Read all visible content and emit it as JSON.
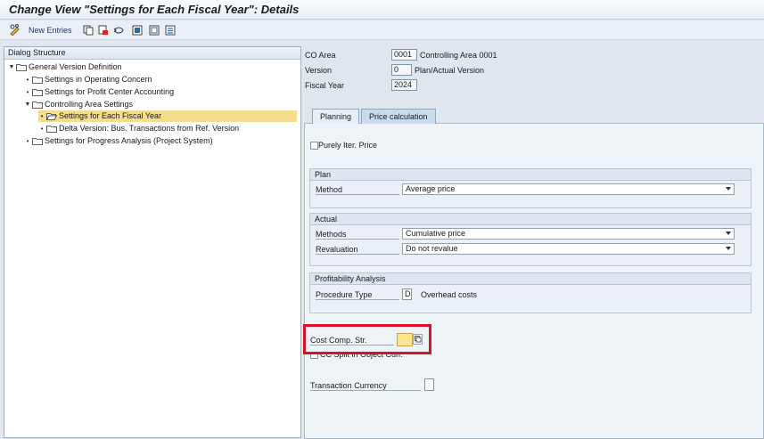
{
  "window": {
    "title": "Change View \"Settings for Each Fiscal Year\": Details"
  },
  "toolbar": {
    "new_entries_label": "New Entries",
    "icons": [
      "pencil-glasses-icon",
      "copy-icon",
      "delete-icon",
      "undo-icon",
      "select-all-icon",
      "deselect-icon",
      "select-block-icon"
    ]
  },
  "dialog_structure": {
    "header": "Dialog Structure",
    "items": [
      {
        "label": "General Version Definition",
        "level": 0,
        "expanded": true
      },
      {
        "label": "Settings in Operating Concern",
        "level": 1
      },
      {
        "label": "Settings for Profit Center Accounting",
        "level": 1
      },
      {
        "label": "Controlling Area Settings",
        "level": 1,
        "expanded": true
      },
      {
        "label": "Settings for Each Fiscal Year",
        "level": 2,
        "selected": true
      },
      {
        "label": "Delta Version: Bus. Transactions from Ref. Version",
        "level": 2
      },
      {
        "label": "Settings for Progress Analysis (Project System)",
        "level": 1
      }
    ]
  },
  "header_fields": {
    "co_area": {
      "label": "CO Area",
      "value": "0001",
      "desc": "Controlling Area 0001"
    },
    "version": {
      "label": "Version",
      "value": "0",
      "desc": "Plan/Actual Version"
    },
    "fiscal_year": {
      "label": "Fiscal Year",
      "value": "2024"
    }
  },
  "tabs": [
    {
      "label": "Planning",
      "active": false
    },
    {
      "label": "Price calculation",
      "active": true
    }
  ],
  "price_calc": {
    "purely_iter_price_label": "Purely Iter. Price",
    "plan": {
      "title": "Plan",
      "method_label": "Method",
      "method_value": "Average price"
    },
    "actual": {
      "title": "Actual",
      "methods_label": "Methods",
      "methods_value": "Cumulative price",
      "revaluation_label": "Revaluation",
      "revaluation_value": "Do not revalue"
    },
    "profitability": {
      "title": "Profitability Analysis",
      "procedure_label": "Procedure Type",
      "procedure_value": "D",
      "procedure_desc": "Overhead costs"
    },
    "cost_comp_label": "Cost Comp. Str.",
    "cc_split_label": "CC Split in Object Curr.",
    "transaction_currency_label": "Transaction Currency"
  },
  "colors": {
    "highlight": "#d8102a",
    "selected_row": "#f6dd8b",
    "input_focus": "#fbe58f"
  }
}
